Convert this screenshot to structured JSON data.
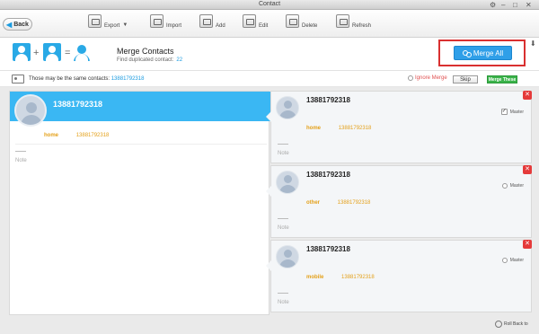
{
  "window": {
    "title": "Contact"
  },
  "toolbar": {
    "back_label": "Back",
    "export_label": "Export",
    "import_label": "Import",
    "add_label": "Add",
    "edit_label": "Edit",
    "delete_label": "Delete",
    "refresh_label": "Refresh"
  },
  "merge": {
    "title": "Merge Contacts",
    "subtitle": "Find duplicated contact:",
    "count": "22",
    "merge_all_label": "Merge All"
  },
  "info": {
    "text": "Those may be the same contacts:",
    "number": "13881792318",
    "ignore_label": "Ignore Merge",
    "skip_label": "Skip",
    "merge_these_label": "Merge These"
  },
  "primary_contact": {
    "name": "13881792318",
    "field_label": "home",
    "field_value": "13881792318",
    "note_label": "Note"
  },
  "duplicates": [
    {
      "name": "13881792318",
      "field_label": "home",
      "field_value": "13881792318",
      "note_label": "Note",
      "master_label": "Master",
      "master_checked": true
    },
    {
      "name": "13881792318",
      "field_label": "other",
      "field_value": "13881792318",
      "note_label": "Note",
      "master_label": "Master",
      "master_checked": false
    },
    {
      "name": "13881792318",
      "field_label": "mobile",
      "field_value": "13881792318",
      "note_label": "Note",
      "master_label": "Master",
      "master_checked": false
    }
  ],
  "footer": {
    "rollback_label": "Roll Back to"
  },
  "colors": {
    "accent": "#3ab7f3",
    "field": "#e4a11b",
    "danger": "#e53a3a",
    "confirm": "#3bb34a"
  }
}
